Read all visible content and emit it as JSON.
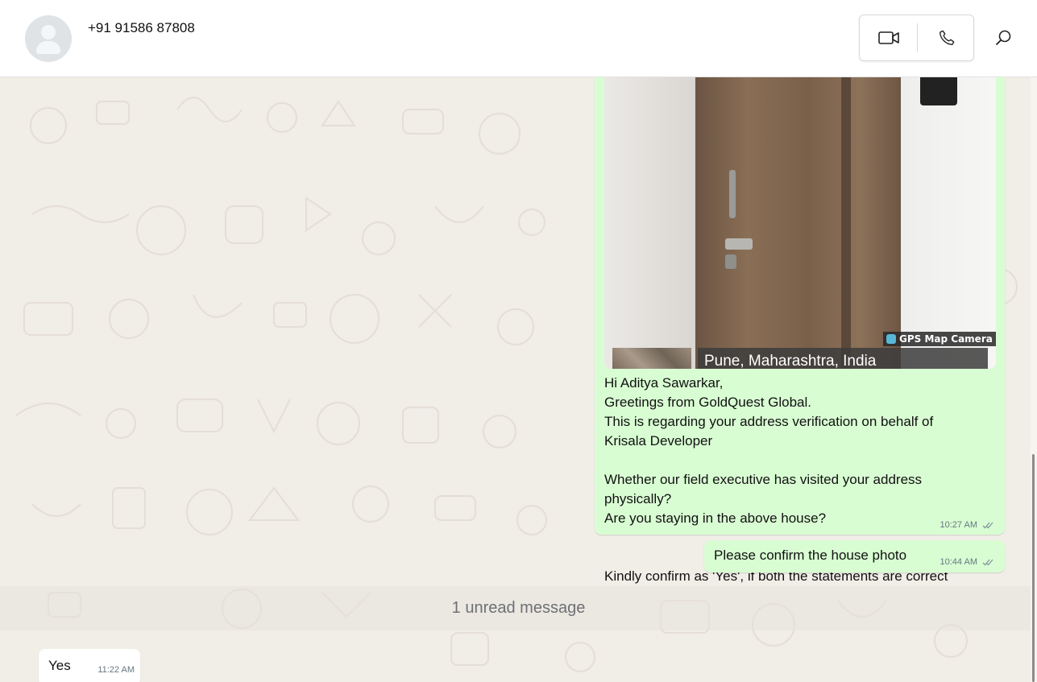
{
  "header": {
    "contact": "+91 91586 87808",
    "video_icon": "video-camera-icon",
    "voice_icon": "phone-icon",
    "search_icon": "search-icon"
  },
  "messages": [
    {
      "direction": "outgoing",
      "image": {
        "badge": "GPS Map Camera",
        "location": "Pune, Maharashtra, India"
      },
      "text": "Hi Aditya Sawarkar,\nGreetings from GoldQuest Global.\nThis is regarding your address verification on behalf of\nKrisala Developer\n\nWhether our field executive has visited your address\nphysically?\nAre you staying in the above house?\n\n\nKindly confirm as 'Yes', if both the statements are correct",
      "time": "10:27 AM",
      "status_icon": "double-check-icon"
    },
    {
      "direction": "outgoing",
      "text": "Please confirm the house photo",
      "time": "10:44 AM",
      "status_icon": "double-check-icon"
    },
    {
      "direction": "incoming",
      "text": "Yes",
      "time": "11:22 AM"
    }
  ],
  "unread_divider": "1 unread message",
  "colors": {
    "outgoing_bubble": "#d9fdd3",
    "incoming_bubble": "#ffffff",
    "chat_background": "#f1ede7"
  }
}
